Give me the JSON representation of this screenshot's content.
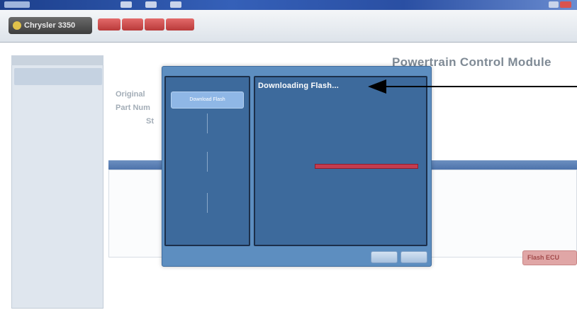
{
  "window": {
    "title": "",
    "buttons": [
      "min-button",
      "max-button",
      "close-button"
    ]
  },
  "header": {
    "brand": "Chrysler 3350",
    "nav": [
      "",
      "",
      "",
      ""
    ],
    "info_line1": "",
    "info_line2": ""
  },
  "page": {
    "top_strip_label": "",
    "module_title": "Powertrain Control Module",
    "original_label": "Original",
    "part_number_label": "Part Num",
    "status_label": "St",
    "section_caption": "",
    "table_header": "",
    "flash_button": "Flash ECU"
  },
  "sidebar": {
    "header": "",
    "item": "",
    "footer": ""
  },
  "modal": {
    "title": "",
    "steps": [
      "Download Flash",
      "",
      "",
      ""
    ],
    "active_step_index": 0,
    "heading": "Downloading Flash...",
    "progress_label": "",
    "progress_fraction": 1.0,
    "buttons": [
      "",
      ""
    ]
  },
  "colors": {
    "modal_bg": "#5d8ec0",
    "panel_bg": "#3d6a9c",
    "progress": "#c43c4f",
    "nav_button": "#b93a3a",
    "annotation_arrow": "#000000"
  }
}
